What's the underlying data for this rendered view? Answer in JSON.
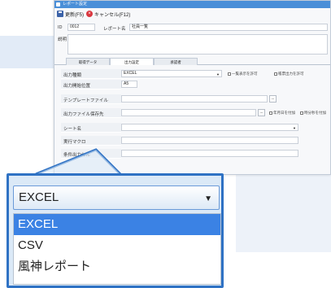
{
  "window": {
    "title": "レポート設定"
  },
  "toolbar": {
    "update_label": "更新(F5)",
    "cancel_label": "キャンセル(F12)"
  },
  "header": {
    "id_label": "ID",
    "id_value": "0012",
    "name_label": "レポート名",
    "name_value": "社員一覧",
    "desc_label": "説明"
  },
  "tabs": [
    {
      "label": "取得データ",
      "active": false
    },
    {
      "label": "出力設定",
      "active": true
    },
    {
      "label": "承認者",
      "active": false
    }
  ],
  "form": {
    "output_type_label": "出力種類",
    "output_type_value": "EXCEL",
    "check_preview": "一覧表示を許可",
    "check_batch": "帳票出力を許可",
    "start_pos_label": "出力開始位置",
    "start_pos_value": "A5",
    "template_label": "テンプレートファイル",
    "template_value": "",
    "save_dest_label": "出力ファイル保存先",
    "save_dest_value": "",
    "check_yearmonth": "年月日を付加",
    "check_time": "時分秒を付加",
    "sheet_label": "シート名",
    "sheet_value": "",
    "macro_label": "実行マクロ",
    "macro_value": "",
    "cond_cell_label": "条件出力セル",
    "cond_cell_value": "",
    "ellipsis": "..."
  },
  "zoom": {
    "selected": "EXCEL",
    "options": [
      "EXCEL",
      "CSV",
      "風神レポート"
    ],
    "highlighted_index": 0
  },
  "colors": {
    "accent": "#2f72c4",
    "highlight": "#3b82e4",
    "titlebar": "#4a8fd8"
  },
  "icons": {
    "save": "save-icon",
    "cancel": "cancel-icon",
    "dropdown": "chevron-down-icon"
  }
}
